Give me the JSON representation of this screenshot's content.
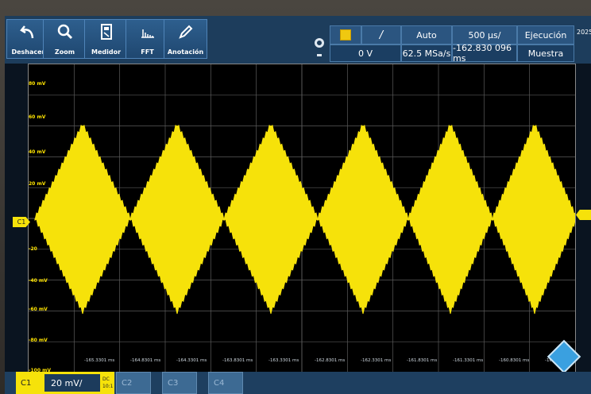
{
  "toolbar": {
    "buttons": [
      {
        "label": "Deshacer",
        "icon": "undo-icon"
      },
      {
        "label": "Zoom",
        "icon": "magnifier-icon"
      },
      {
        "label": "Medidor",
        "icon": "meter-icon"
      },
      {
        "label": "FFT",
        "icon": "fft-icon"
      },
      {
        "label": "Anotación",
        "icon": "pencil-icon"
      }
    ]
  },
  "trigger": {
    "level": "0 V",
    "mode": "Auto",
    "timebase": "500 µs/",
    "sample_rate": "62.5 MSa/s",
    "position": "-162.830 096 ms",
    "run_state": "Ejecución",
    "acq_mode": "Muestra",
    "date_partial": "2025-"
  },
  "plot": {
    "y_labels": [
      "80 mV",
      "60 mV",
      "40 mV",
      "20 mV",
      "-20",
      "-40 mV",
      "-60 mV",
      "-80 mV",
      "-100 mV"
    ],
    "t_labels": [
      "-165.3301 ms",
      "-164.8301 ms",
      "-164.3301 ms",
      "-163.8301 ms",
      "-163.3301 ms",
      "-162.8301 ms",
      "-162.3301 ms",
      "-161.8301 ms",
      "-161.3301 ms",
      "-160.8301 ms",
      "-160.3301 ms"
    ],
    "channel_marker": "C1",
    "trace_color": "#f6e20a"
  },
  "channels": {
    "c1": {
      "name": "C1",
      "scale": "20 mV/",
      "coupling": "DC",
      "probe": "10:1"
    },
    "others": [
      "C2",
      "C3",
      "C4"
    ]
  }
}
